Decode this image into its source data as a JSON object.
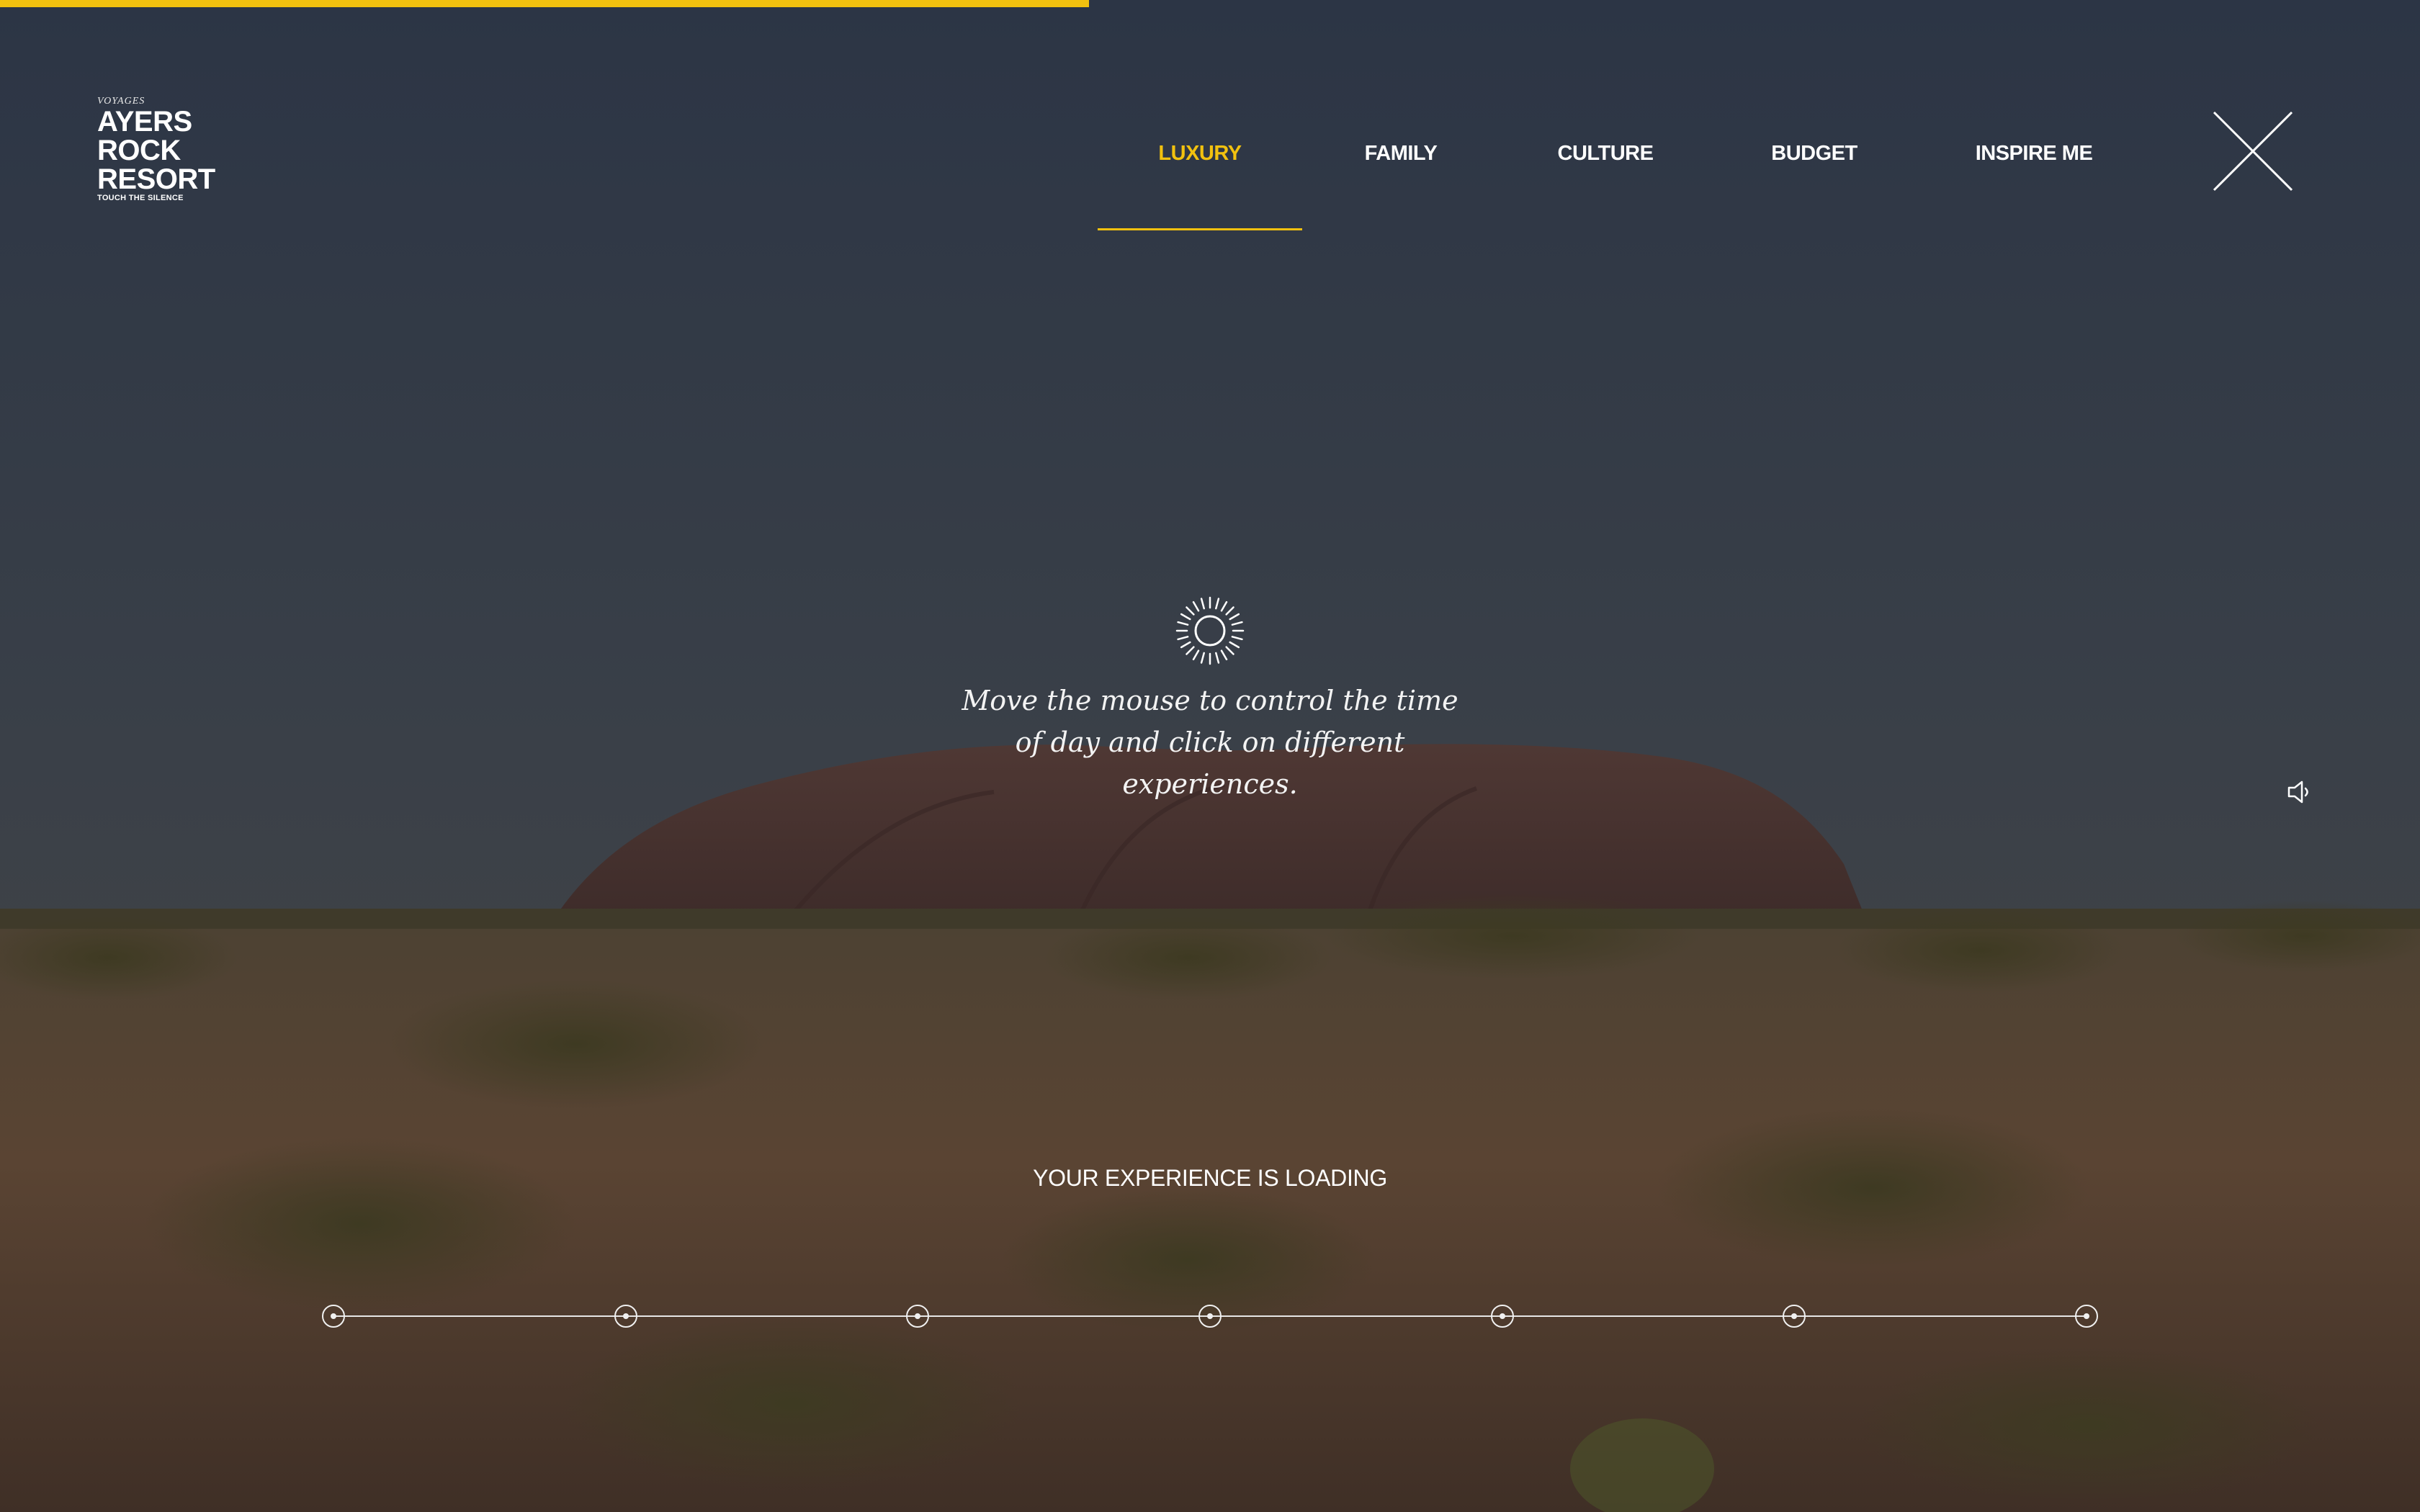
{
  "loading": {
    "progress": 0.45,
    "accent_color": "#f2c10f",
    "message": "YOUR EXPERIENCE IS LOADING"
  },
  "logo": {
    "overline": "VOYAGES",
    "line1": "AYERS",
    "line2": "ROCK",
    "line3": "RESORT",
    "tagline": "TOUCH THE SILENCE"
  },
  "nav": {
    "items": [
      {
        "label": "LUXURY",
        "active": true
      },
      {
        "label": "FAMILY",
        "active": false
      },
      {
        "label": "CULTURE",
        "active": false
      },
      {
        "label": "BUDGET",
        "active": false
      },
      {
        "label": "INSPIRE ME",
        "active": false
      }
    ],
    "close_icon": "close-icon"
  },
  "hero": {
    "icon": "sun-icon",
    "instruction": "Move the mouse to control the time of day and click on different experiences."
  },
  "controls": {
    "sound_icon": "speaker-icon"
  },
  "timeline": {
    "node_count": 7,
    "node_icon": "timeline-node-icon"
  }
}
